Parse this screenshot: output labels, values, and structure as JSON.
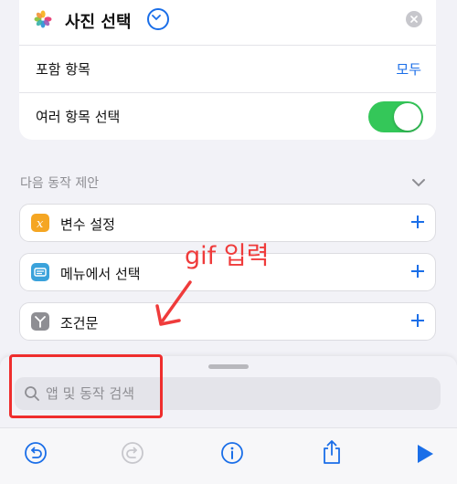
{
  "action": {
    "title": "사진 선택",
    "app_icon": "photos-icon",
    "rows": [
      {
        "label": "포함 항목",
        "value": "모두"
      },
      {
        "label": "여러 항목 선택",
        "toggle": true
      }
    ]
  },
  "suggestions": {
    "title": "다음 동작 제안",
    "items": [
      {
        "label": "변수 설정",
        "icon": "variable-icon",
        "color": "#f5a623"
      },
      {
        "label": "메뉴에서 선택",
        "icon": "menu-icon",
        "color": "#3aa2db"
      },
      {
        "label": "조건문",
        "icon": "branch-icon",
        "color": "#8e8e93"
      }
    ]
  },
  "annotation": {
    "text": "gif 입력",
    "color": "#ef3b3b"
  },
  "search": {
    "placeholder": "앱 및 동작 검색"
  },
  "toolbar": {
    "buttons": [
      "undo-icon",
      "redo-icon",
      "info-icon",
      "share-icon",
      "play-icon"
    ]
  },
  "colors": {
    "accent": "#1a6ee8",
    "toggle_on": "#34c759"
  }
}
